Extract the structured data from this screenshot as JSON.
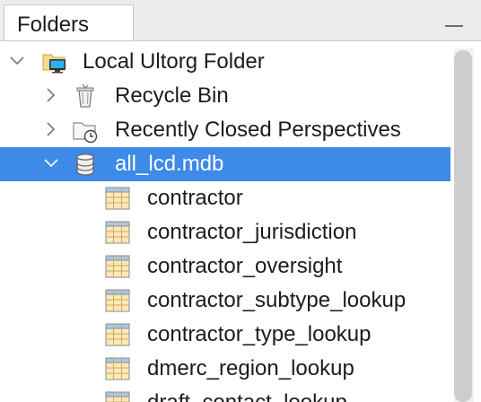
{
  "panel": {
    "tab_label": "Folders"
  },
  "tree": [
    {
      "label": "Local Ultorg Folder",
      "icon": "local-folder-icon",
      "chevron": "down",
      "level": 0
    },
    {
      "label": "Recycle Bin",
      "icon": "recycle-bin-icon",
      "chevron": "right",
      "level": 1
    },
    {
      "label": "Recently Closed Perspectives",
      "icon": "recent-folder-clock-icon",
      "chevron": "right",
      "level": 1
    },
    {
      "label": "all_lcd.mdb",
      "icon": "database-icon",
      "chevron": "down",
      "level": 1,
      "selected": true
    },
    {
      "label": "contractor",
      "icon": "table-icon",
      "level": 2
    },
    {
      "label": "contractor_jurisdiction",
      "icon": "table-icon",
      "level": 2
    },
    {
      "label": "contractor_oversight",
      "icon": "table-icon",
      "level": 2
    },
    {
      "label": "contractor_subtype_lookup",
      "icon": "table-icon",
      "level": 2
    },
    {
      "label": "contractor_type_lookup",
      "icon": "table-icon",
      "level": 2
    },
    {
      "label": "dmerc_region_lookup",
      "icon": "table-icon",
      "level": 2
    },
    {
      "label": "draft_contact_lookup",
      "icon": "table-icon",
      "level": 2
    }
  ],
  "colors": {
    "selection": "#3d8ae8",
    "table_icon_fill": "#fde9b8",
    "table_icon_header": "#a9c9ea"
  }
}
